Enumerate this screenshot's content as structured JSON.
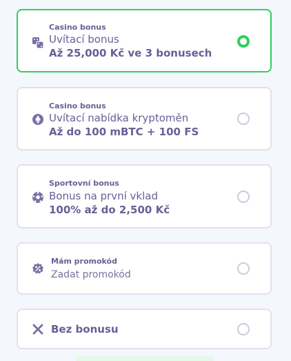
{
  "accent": "#2fcf5c",
  "options": [
    {
      "label": "Casino bonus",
      "title": "Uvítací bonus",
      "subtitle": "Až 25,000 Kč ve 3 bonusech",
      "icon": "dice-icon",
      "selected": true
    },
    {
      "label": "Casino bonus",
      "title": "Uvítací nabídka kryptoměn",
      "subtitle": "Až do 100 mBTC + 100 FS",
      "icon": "ethereum-icon",
      "selected": false
    },
    {
      "label": "Sportovní bonus",
      "title": "Bonus na první vklad",
      "subtitle": "100% až do 2,500 Kč",
      "icon": "soccer-ball-icon",
      "selected": false
    },
    {
      "label": "Mám promokód",
      "placeholder": "Zadat promokód",
      "icon": "percent-badge-icon",
      "selected": false
    },
    {
      "title": "Bez bonusu",
      "icon": "x-icon",
      "selected": false
    }
  ]
}
